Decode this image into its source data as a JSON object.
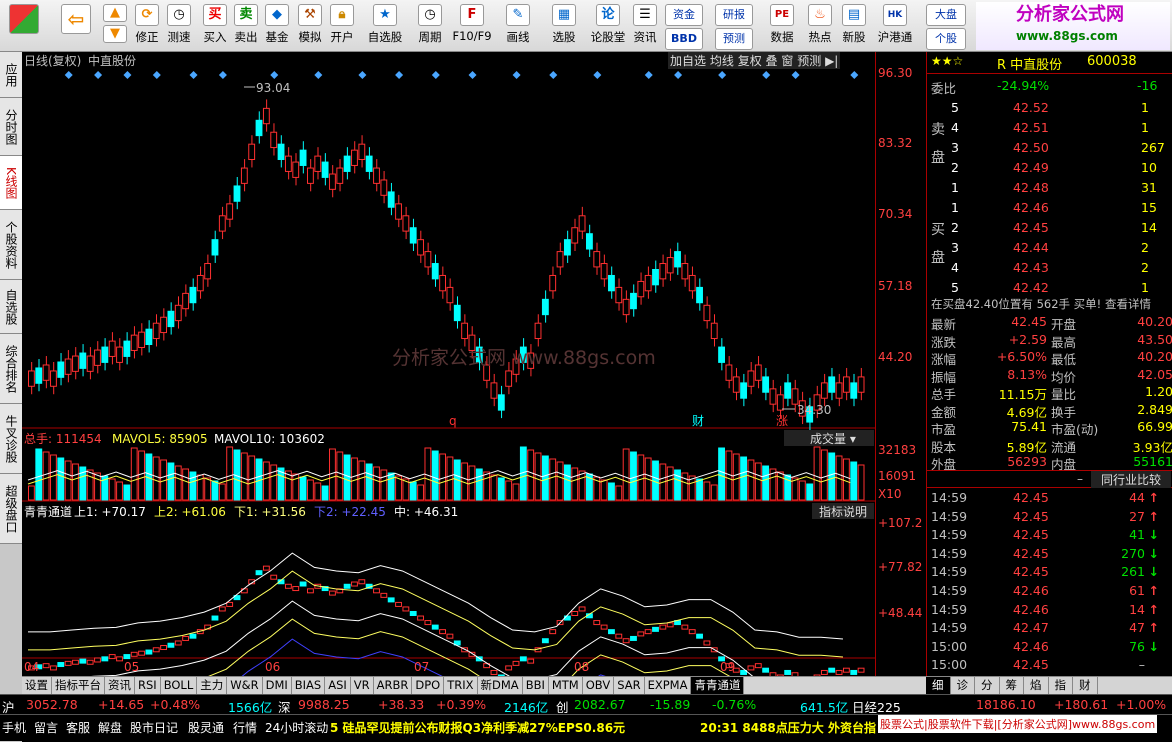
{
  "toolbar": {
    "items": [
      "买入",
      "卖出",
      "基金",
      "模拟",
      "开户",
      "自选股",
      "周期",
      "F10/F9",
      "画线",
      "选股",
      "论股堂",
      "资讯",
      "资金",
      "研报",
      "数据",
      "热点",
      "新股",
      "沪港通",
      "大盘"
    ],
    "nav": [
      "修正",
      "测速"
    ],
    "extra": [
      "BBD",
      "预测",
      "个股"
    ]
  },
  "brand": {
    "name": "分析家公式网",
    "url": "www.88gs.com"
  },
  "lefttabs": [
    "应用",
    "分时图",
    "K线图",
    "个股资料",
    "自选股",
    "综合排名",
    "牛叉诊股",
    "超级盘口"
  ],
  "chart": {
    "title": "日线(复权)",
    "stock": "中直股份",
    "buttons": [
      "加自选",
      "均线",
      "复权",
      "叠",
      "窗",
      "预测"
    ],
    "price_ticks": [
      "96.30",
      "83.32",
      "70.34",
      "57.18",
      "44.20"
    ],
    "high_label": "93.04",
    "low_label": "34.30",
    "markers": [
      "q",
      "财",
      "涨"
    ],
    "volume_label": "总手: 111454",
    "mavol5": "MAVOL5: 85905",
    "mavol10": "MAVOL10: 103602",
    "vol_button": "成交量",
    "vol_ticks": [
      "32183",
      "16091",
      "X10"
    ],
    "ind_name": "青青通道",
    "ind_up1": "上1: +70.17",
    "ind_up2": "上2: +61.06",
    "ind_dn1": "下1: +31.56",
    "ind_dn2": "下2: +22.45",
    "ind_mid": "中: +46.31",
    "ind_button": "指标说明",
    "ind_ticks": [
      "+107.2",
      "+77.82",
      "+48.44"
    ],
    "months": [
      "04",
      "05",
      "06",
      "07",
      "08",
      "09"
    ],
    "watermark": "分析家公式网  www.88gs.com"
  },
  "quote": {
    "code": "600038",
    "name": "R 中直股份",
    "weibi_label": "委比",
    "weibi": "-24.94%",
    "weicha": "-16",
    "sell": [
      {
        "n": "5",
        "p": "42.52",
        "v": "1"
      },
      {
        "n": "4",
        "p": "42.51",
        "v": "1"
      },
      {
        "n": "3",
        "p": "42.50",
        "v": "267"
      },
      {
        "n": "2",
        "p": "42.49",
        "v": "10"
      },
      {
        "n": "1",
        "p": "42.48",
        "v": "31"
      }
    ],
    "buy": [
      {
        "n": "1",
        "p": "42.46",
        "v": "15"
      },
      {
        "n": "2",
        "p": "42.45",
        "v": "14"
      },
      {
        "n": "3",
        "p": "42.44",
        "v": "2"
      },
      {
        "n": "4",
        "p": "42.43",
        "v": "2"
      },
      {
        "n": "5",
        "p": "42.42",
        "v": "1"
      }
    ],
    "sell_label": "卖盘",
    "buy_label": "买盘",
    "notice": "在买盘42.40位置有 562手 买单! 查看详情",
    "stats": [
      [
        "最新",
        "42.45",
        "开盘",
        "40.20"
      ],
      [
        "涨跌",
        "+2.59",
        "最高",
        "43.50"
      ],
      [
        "涨幅",
        "+6.50%",
        "最低",
        "40.20"
      ],
      [
        "振幅",
        "8.13%",
        "均价",
        "42.05"
      ],
      [
        "总手",
        "11.15万",
        "量比",
        "1.20"
      ],
      [
        "金额",
        "4.69亿",
        "换手",
        "2.849"
      ],
      [
        "市盈",
        "75.41",
        "市盈(动)",
        "66.99"
      ],
      [
        "股本",
        "5.89亿",
        "流通",
        "3.93亿"
      ],
      [
        "外盘",
        "56293",
        "内盘",
        "55161"
      ]
    ],
    "industry_button": "同行业比较",
    "ticks": [
      [
        "14:59",
        "42.45",
        "44"
      ],
      [
        "14:59",
        "42.45",
        "27"
      ],
      [
        "14:59",
        "42.45",
        "41"
      ],
      [
        "14:59",
        "42.45",
        "270"
      ],
      [
        "14:59",
        "42.45",
        "261"
      ],
      [
        "14:59",
        "42.46",
        "61"
      ],
      [
        "14:59",
        "42.46",
        "14"
      ],
      [
        "14:59",
        "42.47",
        "47"
      ],
      [
        "15:00",
        "42.46",
        "76"
      ],
      [
        "15:00",
        "42.45",
        "–"
      ]
    ],
    "right_tabs": [
      "细",
      "诊",
      "分",
      "筹",
      "焰",
      "指",
      "财"
    ]
  },
  "bottomtabs": [
    "设置",
    "指标平台",
    "资讯",
    "RSI",
    "BOLL",
    "主力",
    "W&R",
    "DMI",
    "BIAS",
    "ASI",
    "VR",
    "ARBR",
    "DPO",
    "TRIX",
    "新DMA",
    "BBI",
    "MTM",
    "OBV",
    "SAR",
    "EXPMA",
    "青青通道"
  ],
  "status": {
    "sh": "沪",
    "sh_val": "3052.78",
    "sh_chg": "+14.65",
    "sh_pct": "+0.48%",
    "sh_amt": "1566亿",
    "sz": "深",
    "sz_val": "9988.25",
    "sz_chg": "+38.33",
    "sz_pct": "+0.39%",
    "sz_amt": "2146亿",
    "cy": "创",
    "cy_val": "2082.67",
    "cy_chg": "-15.89",
    "cy_pct": "-0.76%",
    "cy_amt": "641.5亿",
    "nk": "日经225",
    "nk_val": "18186.10",
    "nk_chg": "+180.61",
    "nk_pct": "+1.00%"
  },
  "ticker": {
    "items": [
      "手机",
      "留言",
      "客服",
      "解盘",
      "股市日记",
      "股灵通",
      "行情",
      "24小时滚动"
    ],
    "news": "5 硅品罕见提前公布财报Q3净利季减27%EPS0.86元",
    "news2": "20:31 8488点压力大 外资台指",
    "ad": "股票公式|股票软件下载|[分析家公式网]www.88gs.com"
  }
}
